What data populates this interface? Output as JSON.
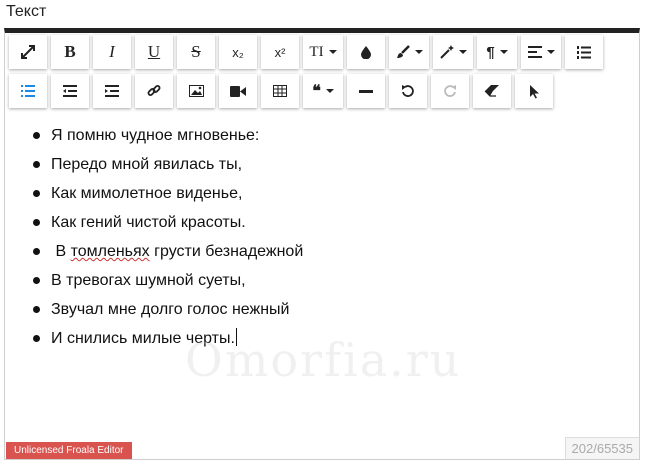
{
  "field_label": "Текст",
  "toolbar": {
    "row1": [
      {
        "name": "fullscreen",
        "glyph": "⤢"
      },
      {
        "name": "bold",
        "glyph": "B"
      },
      {
        "name": "italic",
        "glyph": "I"
      },
      {
        "name": "underline",
        "glyph": "U"
      },
      {
        "name": "strikethrough",
        "glyph": "S"
      },
      {
        "name": "subscript",
        "glyph": "x₂"
      },
      {
        "name": "superscript",
        "glyph": "x²"
      },
      {
        "name": "font-size",
        "glyph": "TI"
      },
      {
        "name": "color",
        "glyph": "♦"
      },
      {
        "name": "paint-style",
        "glyph": "✎"
      },
      {
        "name": "magic",
        "glyph": "✦"
      },
      {
        "name": "paragraph-format",
        "glyph": "¶"
      },
      {
        "name": "align",
        "glyph": "≡"
      },
      {
        "name": "ordered-list",
        "glyph": "≔"
      }
    ],
    "row2": [
      {
        "name": "unordered-list",
        "glyph": "☰"
      },
      {
        "name": "outdent",
        "glyph": "⇤"
      },
      {
        "name": "indent",
        "glyph": "⇥"
      },
      {
        "name": "insert-link",
        "glyph": "🔗"
      },
      {
        "name": "insert-image",
        "glyph": "▣"
      },
      {
        "name": "insert-video",
        "glyph": "▶"
      },
      {
        "name": "insert-table",
        "glyph": "▦"
      },
      {
        "name": "quote",
        "glyph": "❝"
      },
      {
        "name": "insert-hr",
        "glyph": "—"
      },
      {
        "name": "undo",
        "glyph": "↺"
      },
      {
        "name": "redo",
        "glyph": "↻"
      },
      {
        "name": "clear-formatting",
        "glyph": "⌫"
      },
      {
        "name": "select-all",
        "glyph": "➤"
      }
    ]
  },
  "content": {
    "lines": [
      "Я помню чудное мгновенье:",
      "Передо мной явилась ты,",
      "Как мимолетное виденье,",
      "Как гений чистой красоты.",
      " В томленьях грусти безнадежной",
      "В тревогах шумной суеты,",
      "Звучал мне долго голос нежный",
      "И снились милые черты."
    ]
  },
  "watermark": "Omorfia.ru",
  "license_badge": "Unlicensed Froala Editor",
  "char_counter": "202/65535",
  "colors": {
    "accent": "#1e88e5",
    "badge": "#d9534f"
  }
}
